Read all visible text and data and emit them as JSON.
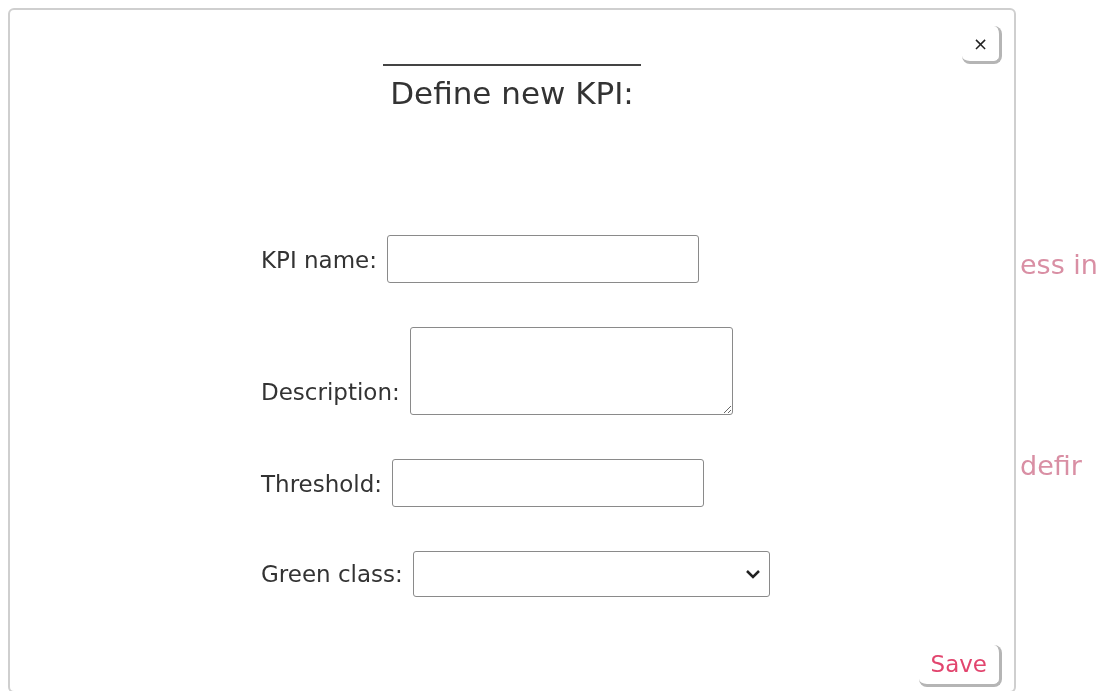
{
  "background": {
    "texts": [
      "ess in",
      "defir"
    ]
  },
  "dialog": {
    "close": "×",
    "title": "Define new KPI:",
    "fields": [
      {
        "kind": "input",
        "label": "KPI name:"
      },
      {
        "kind": "textarea",
        "label": "Description:"
      },
      {
        "kind": "input",
        "label": "Threshold:"
      },
      {
        "kind": "select",
        "label": "Green class:"
      }
    ],
    "save": "Save"
  }
}
